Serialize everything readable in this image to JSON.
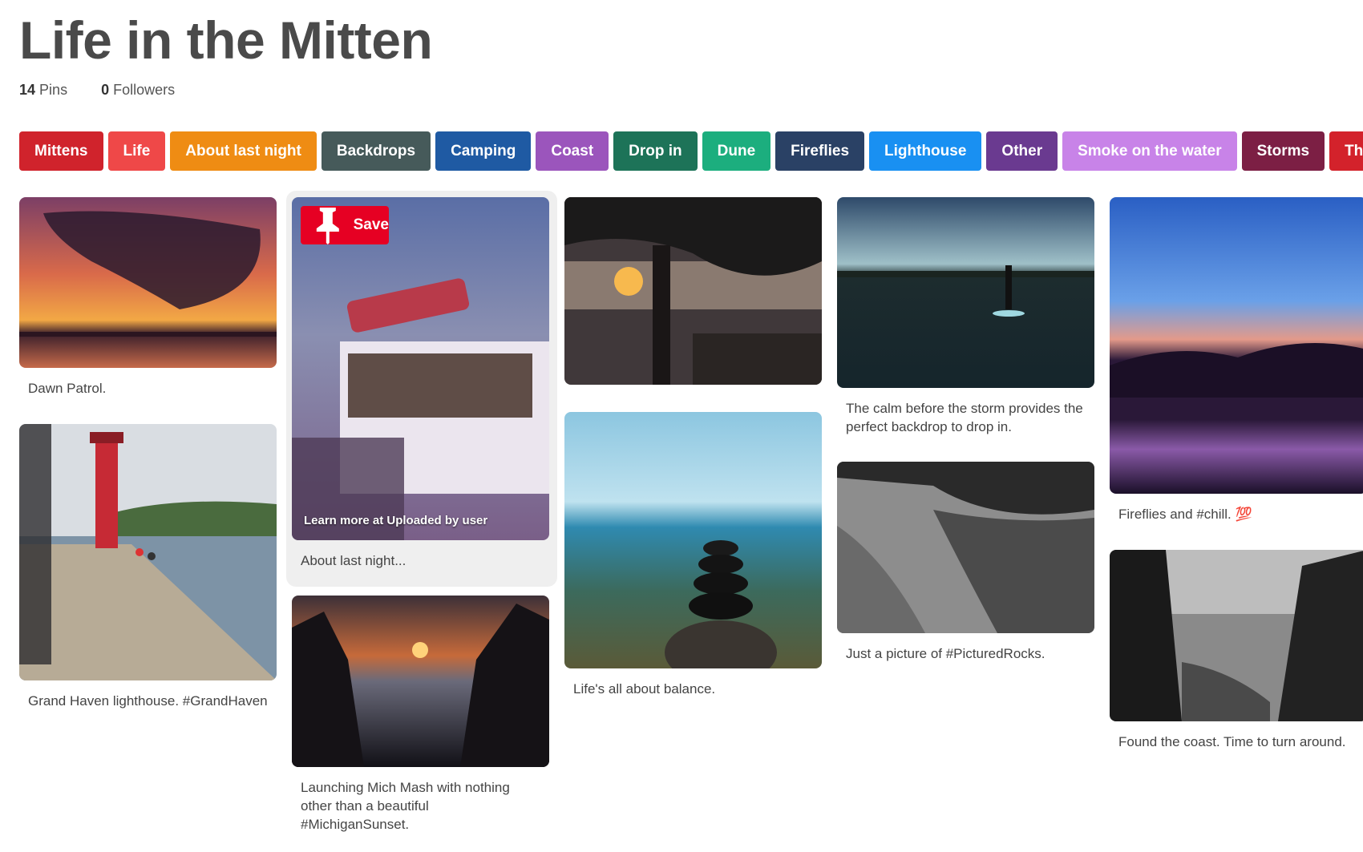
{
  "board": {
    "title": "Life in the Mitten",
    "pins_count": "14",
    "pins_label": "Pins",
    "followers_count": "0",
    "followers_label": "Followers"
  },
  "sections": [
    {
      "label": "Mittens",
      "color": "#d0232c"
    },
    {
      "label": "Life",
      "color": "#ef4848"
    },
    {
      "label": "About last night",
      "color": "#ef8c13"
    },
    {
      "label": "Backdrops",
      "color": "#465a5a"
    },
    {
      "label": "Camping",
      "color": "#1f5aa3"
    },
    {
      "label": "Coast",
      "color": "#9b55bc"
    },
    {
      "label": "Drop in",
      "color": "#1d7358"
    },
    {
      "label": "Dune",
      "color": "#1cae7e"
    },
    {
      "label": "Fireflies",
      "color": "#2a4165"
    },
    {
      "label": "Lighthouse",
      "color": "#1990f2"
    },
    {
      "label": "Other",
      "color": "#6a3a90"
    },
    {
      "label": "Smoke on the water",
      "color": "#c883e8"
    },
    {
      "label": "Storms",
      "color": "#7c1f44"
    },
    {
      "label": "The",
      "color": "#d3222b"
    }
  ],
  "pins": [
    {
      "caption": "Dawn Patrol.",
      "image": "sunset-cloud-lake"
    },
    {
      "caption": "Grand Haven lighthouse. #GrandHaven",
      "image": "red-lighthouse-pier"
    },
    {
      "caption": "About last night...",
      "image": "ice-cream-truck",
      "save_label": "Save",
      "learn_more": "Learn more at Uploaded by user"
    },
    {
      "caption": "Launching Mich Mash with nothing other than a beautiful #MichiganSunset.",
      "image": "sunset-over-lake-trees"
    },
    {
      "caption": "",
      "image": "sunset-through-tree-deck"
    },
    {
      "caption": "Life's all about balance.",
      "image": "stacked-stones-beach"
    },
    {
      "caption": "The calm before the storm provides the perfect backdrop to drop in.",
      "image": "paddleboarder-lake"
    },
    {
      "caption": "Just a picture of #PicturedRocks.",
      "image": "pictured-rocks-bw"
    },
    {
      "caption": "Fireflies and #chill. 💯",
      "image": "twilight-lake-silhouette"
    },
    {
      "caption": "Found the coast. Time to turn around.",
      "image": "coast-hikers-bw"
    }
  ],
  "colors": {
    "save_red": "#e60023",
    "hover_bg": "#efefef"
  },
  "icons": {
    "save": "pushpin-icon"
  }
}
